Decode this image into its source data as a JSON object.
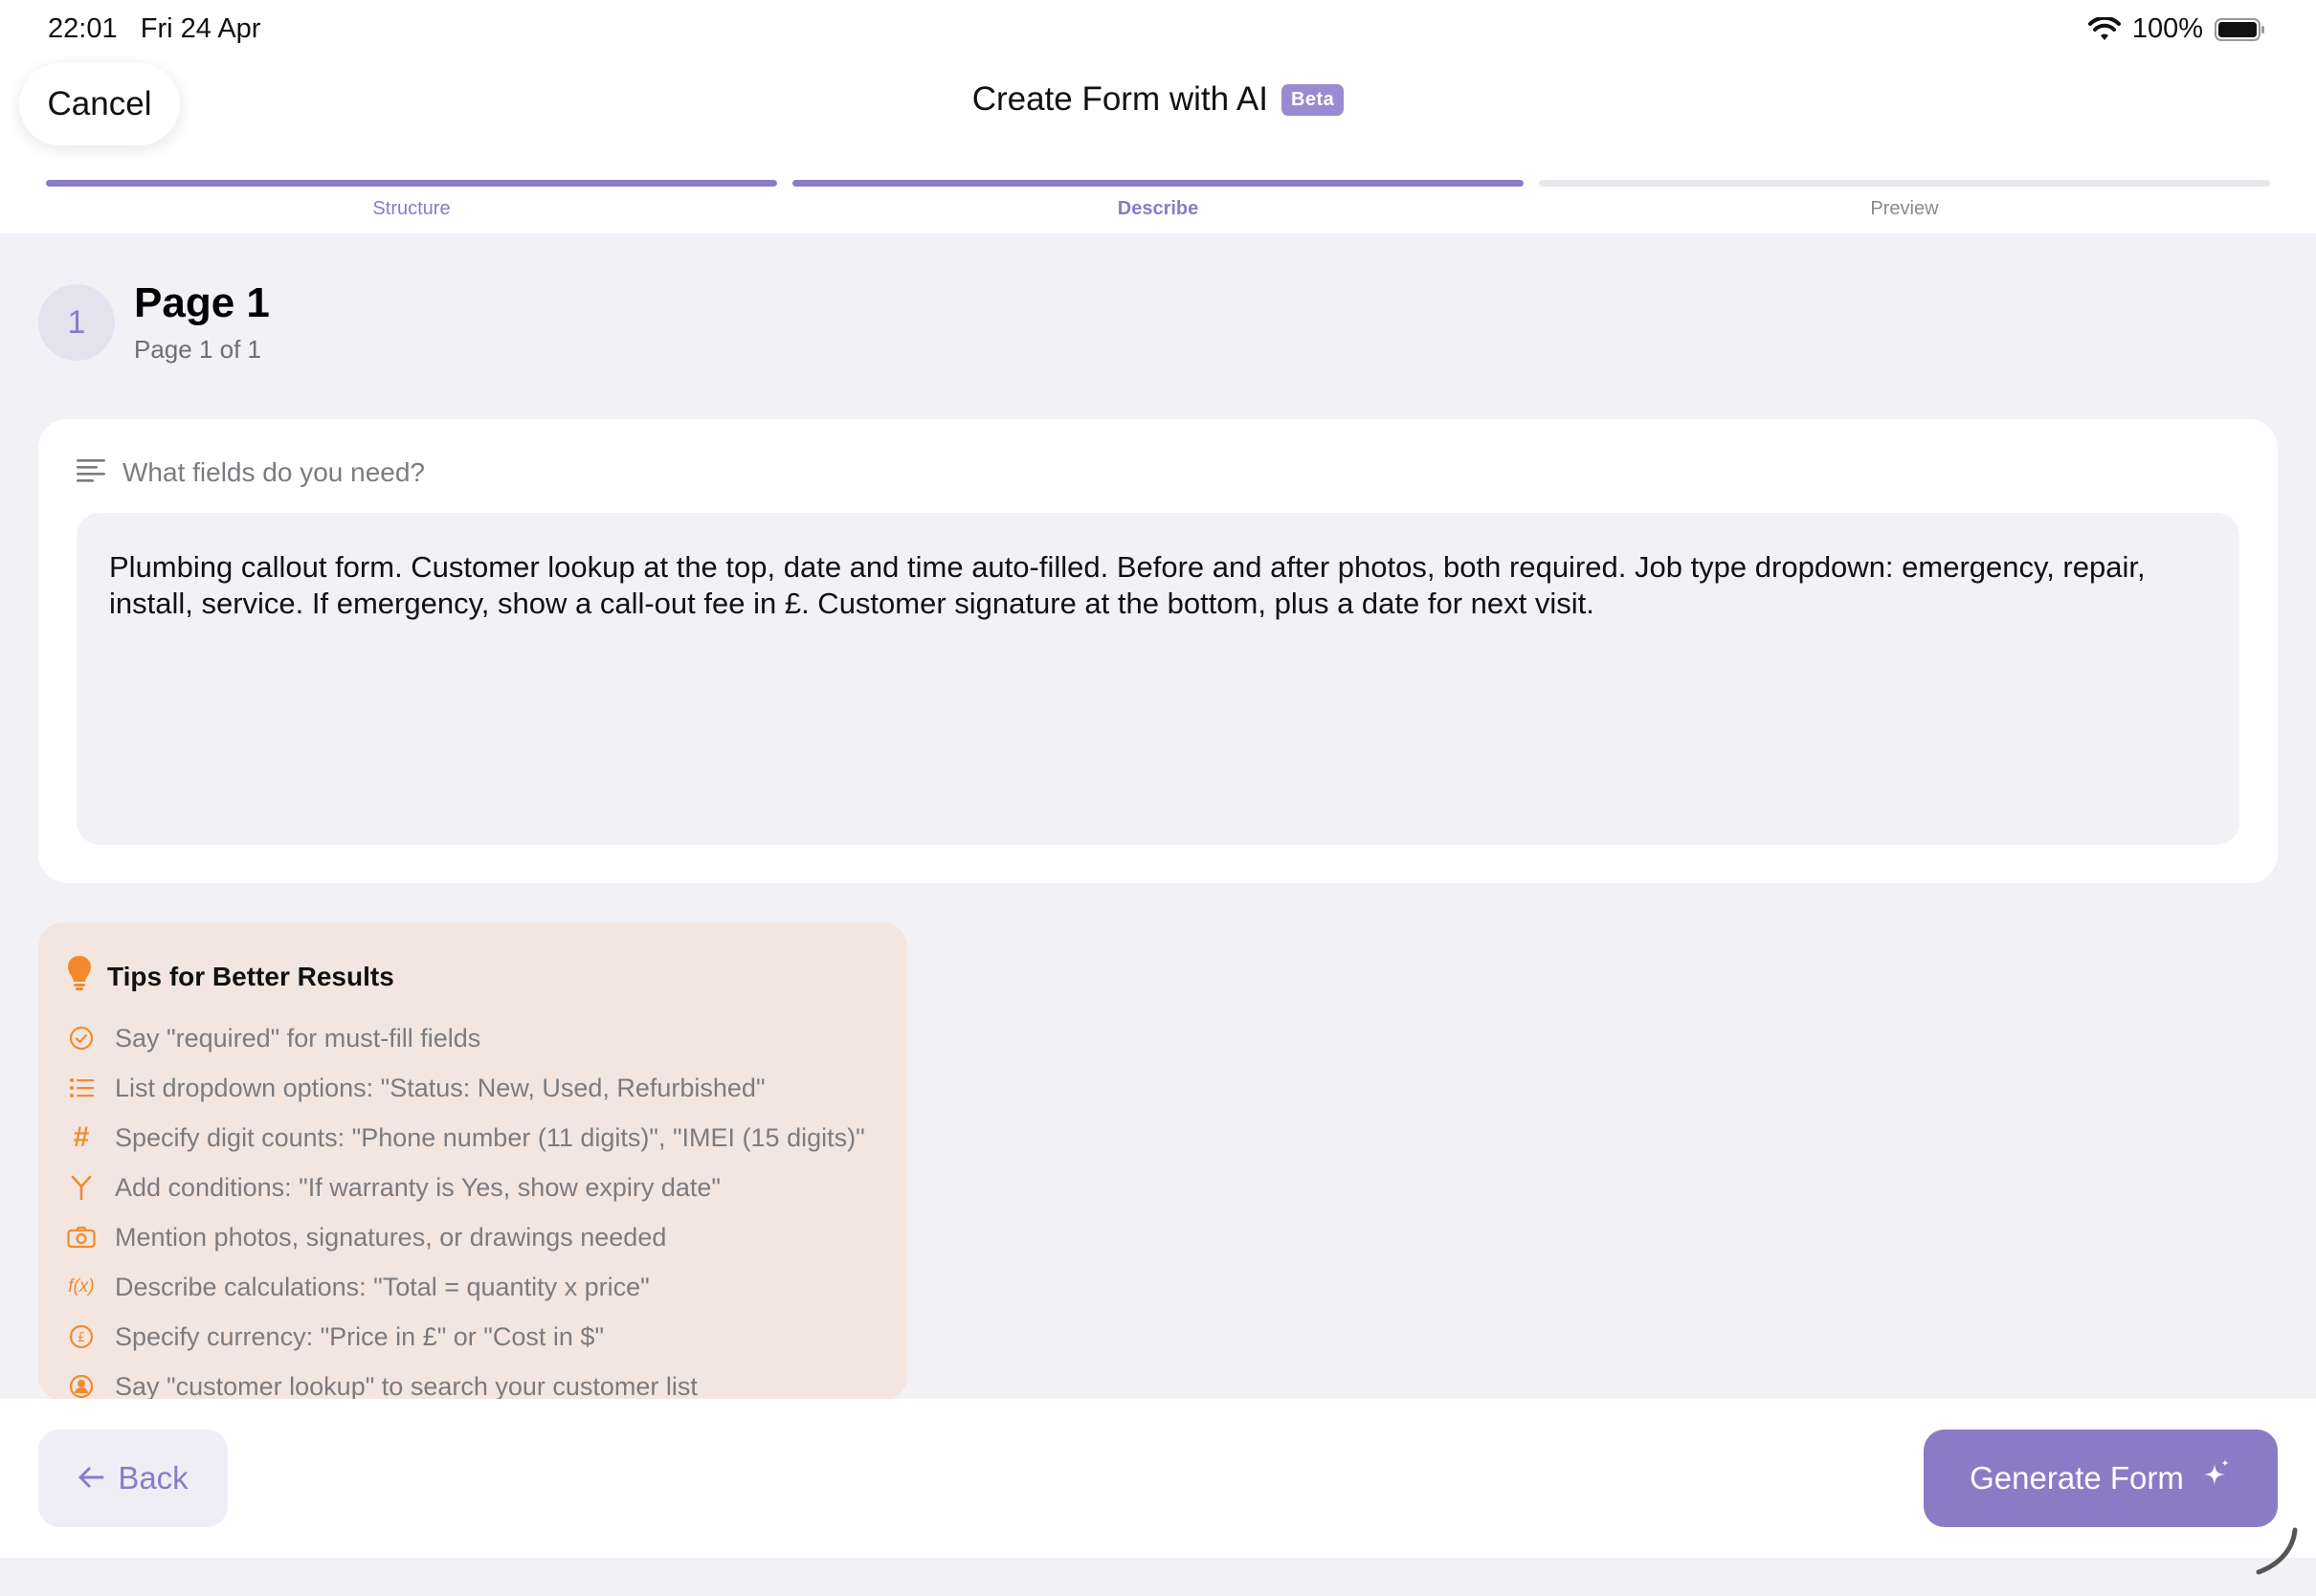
{
  "status": {
    "time": "22:01",
    "date": "Fri 24 Apr",
    "battery": "100%"
  },
  "nav": {
    "cancel_label": "Cancel",
    "title": "Create Form with AI",
    "badge": "Beta"
  },
  "steps": [
    {
      "label": "Structure",
      "state": "done"
    },
    {
      "label": "Describe",
      "state": "active"
    },
    {
      "label": "Preview",
      "state": "todo"
    }
  ],
  "page": {
    "number": "1",
    "title": "Page 1",
    "subtitle": "Page 1 of 1"
  },
  "fields": {
    "question": "What fields do you need?",
    "value": "Plumbing callout form. Customer lookup at the top, date and time auto-filled. Before and after photos, both required. Job type dropdown: emergency, repair, install, service. If emergency, show a call-out fee in £. Customer signature at the bottom, plus a date for next visit."
  },
  "tips": {
    "title": "Tips for Better Results",
    "items": [
      {
        "icon": "check-circle-icon",
        "text": "Say \"required\" for must-fill fields"
      },
      {
        "icon": "list-icon",
        "text": "List dropdown options: \"Status: New, Used, Refurbished\""
      },
      {
        "icon": "hash-icon",
        "text": "Specify digit counts: \"Phone number (11 digits)\", \"IMEI (15 digits)\""
      },
      {
        "icon": "branch-icon",
        "text": "Add conditions: \"If warranty is Yes, show expiry date\""
      },
      {
        "icon": "camera-icon",
        "text": "Mention photos, signatures, or drawings needed"
      },
      {
        "icon": "function-icon",
        "text": "Describe calculations: \"Total = quantity x price\""
      },
      {
        "icon": "pound-circle-icon",
        "text": "Specify currency: \"Price in £\" or \"Cost in $\""
      },
      {
        "icon": "person-circle-icon",
        "text": "Say \"customer lookup\" to search your customer list"
      }
    ]
  },
  "footer": {
    "back_label": "Back",
    "generate_label": "Generate Form"
  },
  "colors": {
    "accent": "#8b7bc6",
    "tip_icon": "#f28a2c",
    "tips_bg": "#f3e6e1"
  }
}
